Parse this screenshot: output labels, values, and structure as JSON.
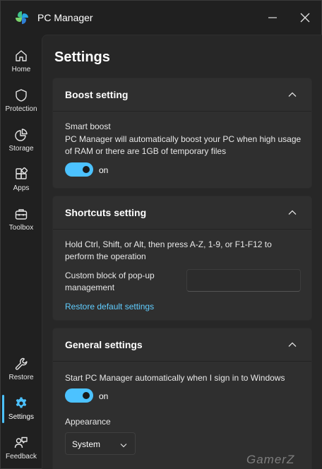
{
  "app": {
    "title": "PC Manager"
  },
  "sidebar": {
    "items": [
      {
        "label": "Home",
        "icon": "home-icon"
      },
      {
        "label": "Protection",
        "icon": "shield-icon"
      },
      {
        "label": "Storage",
        "icon": "pie-chart-icon"
      },
      {
        "label": "Apps",
        "icon": "apps-icon"
      },
      {
        "label": "Toolbox",
        "icon": "toolbox-icon"
      }
    ],
    "bottom_items": [
      {
        "label": "Restore",
        "icon": "wrench-icon"
      },
      {
        "label": "Settings",
        "icon": "gear-icon",
        "active": true
      },
      {
        "label": "Feedback",
        "icon": "feedback-icon"
      }
    ]
  },
  "page": {
    "title": "Settings"
  },
  "boost": {
    "title": "Boost setting",
    "smart_label": "Smart boost",
    "desc_line1": "PC Manager will automatically boost your PC when high usage",
    "desc_line2": "of RAM or there are 1GB of temporary files",
    "toggle_label": "on"
  },
  "shortcuts": {
    "title": "Shortcuts setting",
    "desc_line1": "Hold Ctrl, Shift, or Alt, then press A-Z, 1-9, or F1-F12 to",
    "desc_line2": "perform the operation",
    "popup_line1": "Custom block of pop-up",
    "popup_line2": "management",
    "input_value": "",
    "restore_link": "Restore default settings"
  },
  "general": {
    "title": "General settings",
    "autostart_label": "Start PC Manager automatically when I sign in to Windows",
    "toggle_label": "on",
    "appearance_label": "Appearance",
    "appearance_value": "System"
  },
  "watermark": "GamerZ",
  "colors": {
    "accent": "#4cc2ff",
    "link": "#60cdff",
    "background": "#202020",
    "card": "#2f2f2f"
  }
}
